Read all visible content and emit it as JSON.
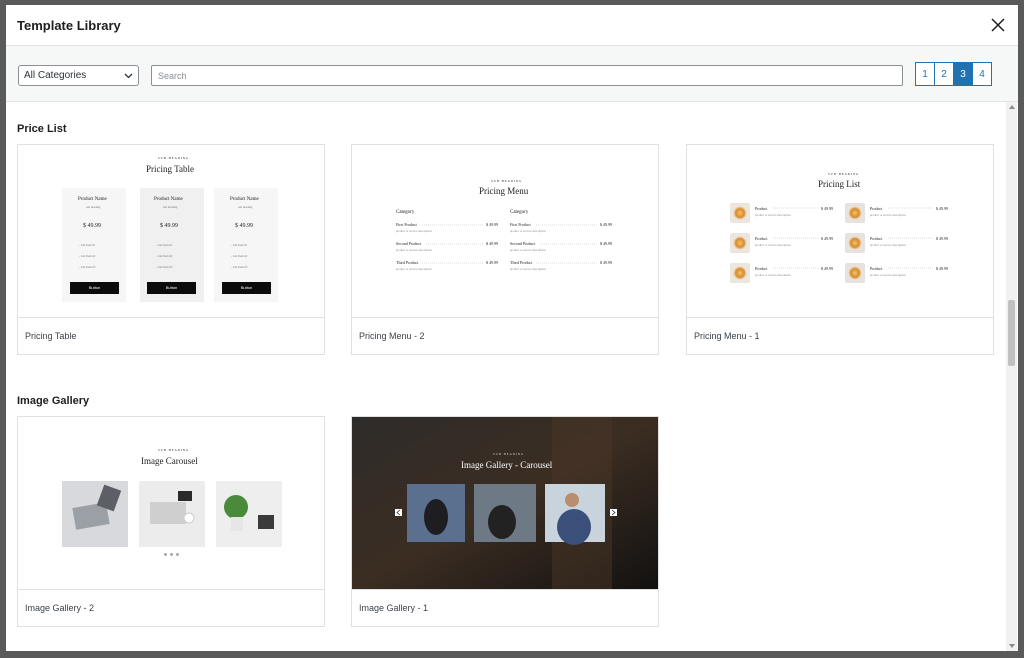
{
  "modal": {
    "title": "Template Library",
    "close_icon": "close-icon"
  },
  "toolbar": {
    "category": "All Categories",
    "search_placeholder": "Search",
    "pages": [
      "1",
      "2",
      "3",
      "4"
    ],
    "active_page": "3"
  },
  "sections": [
    {
      "title": "Price List",
      "cards": [
        {
          "label": "Pricing Table",
          "preview": {
            "kicker": "SUB HEADING",
            "heading": "Pricing Table",
            "product": "Product Name",
            "sub": "sub heading",
            "price": "$ 49.99",
            "items": [
              "- List Item #1",
              "- List Item #2",
              "- List Item #3"
            ],
            "button": "Button"
          }
        },
        {
          "label": "Pricing Menu - 2",
          "preview": {
            "kicker": "SUB HEADING",
            "heading": "Pricing Menu",
            "category": "Category",
            "items": [
              "First Product",
              "Second Product",
              "Third Product"
            ],
            "price": "$ 49.99",
            "desc": "product or service description"
          }
        },
        {
          "label": "Pricing Menu - 1",
          "preview": {
            "kicker": "SUB HEADING",
            "heading": "Pricing List",
            "product": "Product",
            "price": "$ 49.99",
            "desc": "product or service description"
          }
        }
      ]
    },
    {
      "title": "Image Gallery",
      "cards": [
        {
          "label": "Image Gallery - 2",
          "preview": {
            "kicker": "SUB HEADING",
            "heading": "Image Carousel"
          }
        },
        {
          "label": "Image Gallery - 1",
          "preview": {
            "kicker": "SUB HEADING",
            "heading": "Image Gallery - Carousel"
          }
        }
      ]
    }
  ],
  "colors": {
    "accent": "#2271b1",
    "border": "#e0e0e0",
    "toolbar_bg": "#f6f7f7"
  }
}
